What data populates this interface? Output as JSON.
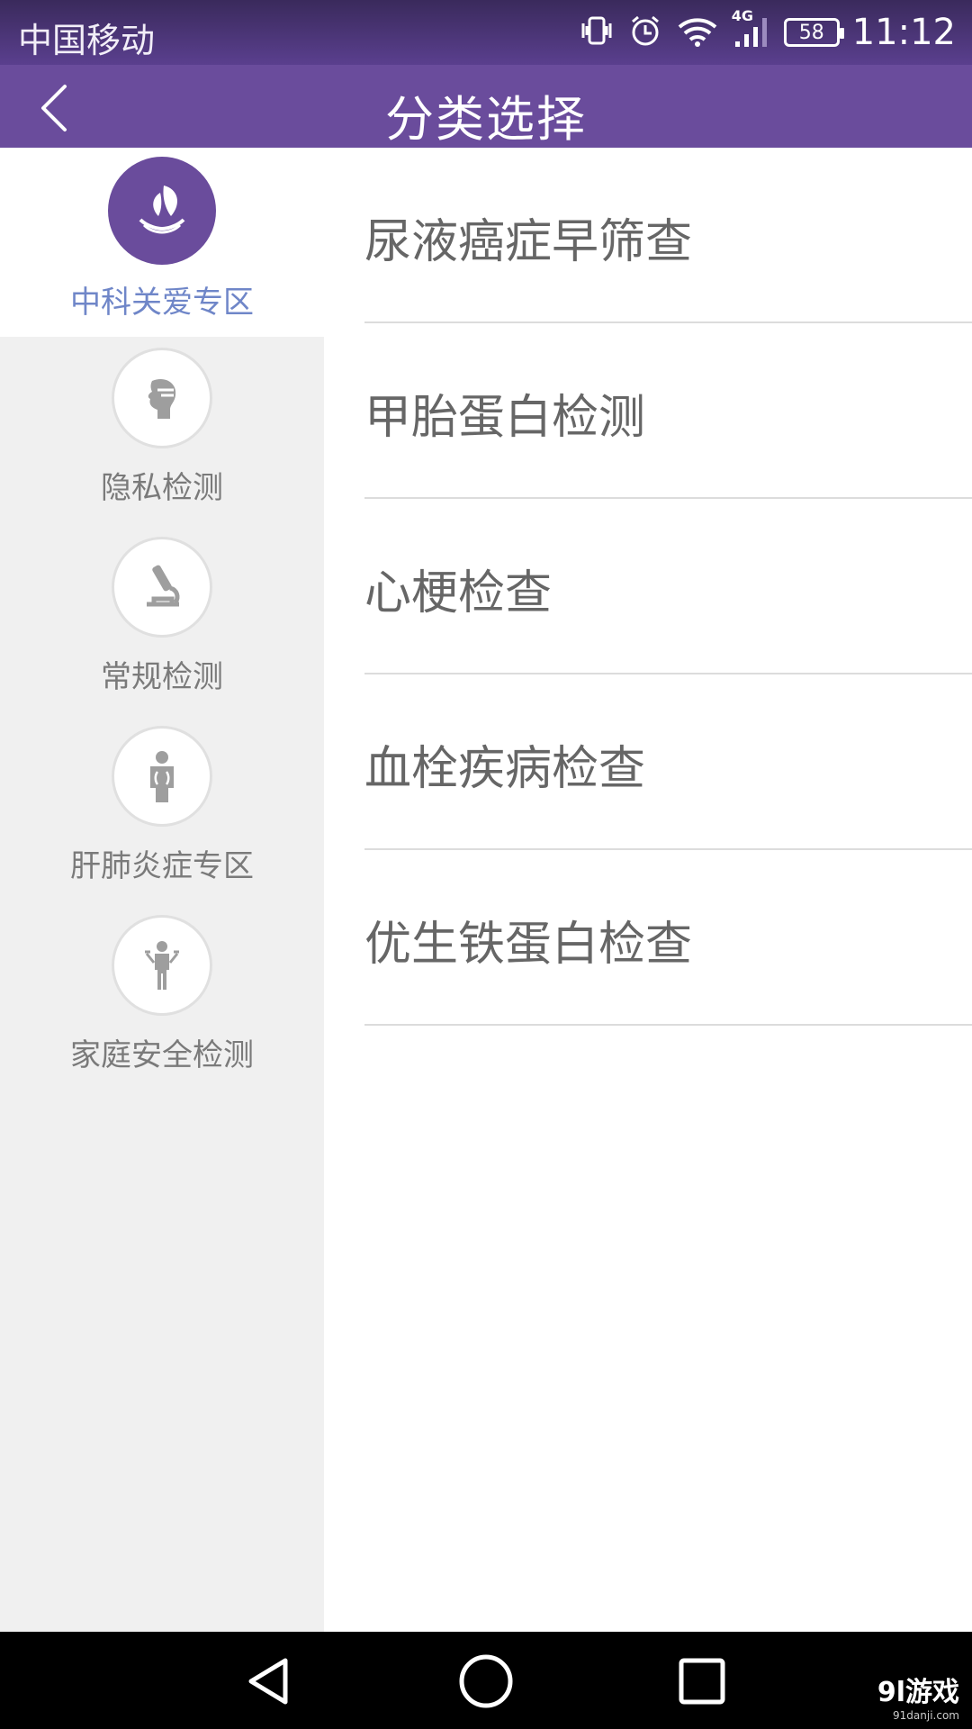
{
  "status_bar": {
    "carrier": "中国移动",
    "network": "4G",
    "battery": "58",
    "time": "11:12"
  },
  "header": {
    "title": "分类选择"
  },
  "sidebar": {
    "items": [
      {
        "label": "中科关爱专区",
        "icon": "leaf-logo-icon",
        "active": true
      },
      {
        "label": "隐私检测",
        "icon": "profile-head-icon",
        "active": false
      },
      {
        "label": "常规检测",
        "icon": "microscope-icon",
        "active": false
      },
      {
        "label": "肝肺炎症专区",
        "icon": "body-organs-icon",
        "active": false
      },
      {
        "label": "家庭安全检测",
        "icon": "family-person-icon",
        "active": false
      }
    ]
  },
  "content": {
    "items": [
      {
        "label": "尿液癌症早筛查"
      },
      {
        "label": "甲胎蛋白检测"
      },
      {
        "label": "心梗检查"
      },
      {
        "label": "血栓疾病检查"
      },
      {
        "label": "优生铁蛋白检查"
      }
    ]
  },
  "watermark": {
    "brand": "9l游戏",
    "url": "91danji.com"
  },
  "colors": {
    "primary": "#6a4c9c",
    "active_label": "#6f86c8",
    "sidebar_bg": "#f0f0f0"
  }
}
